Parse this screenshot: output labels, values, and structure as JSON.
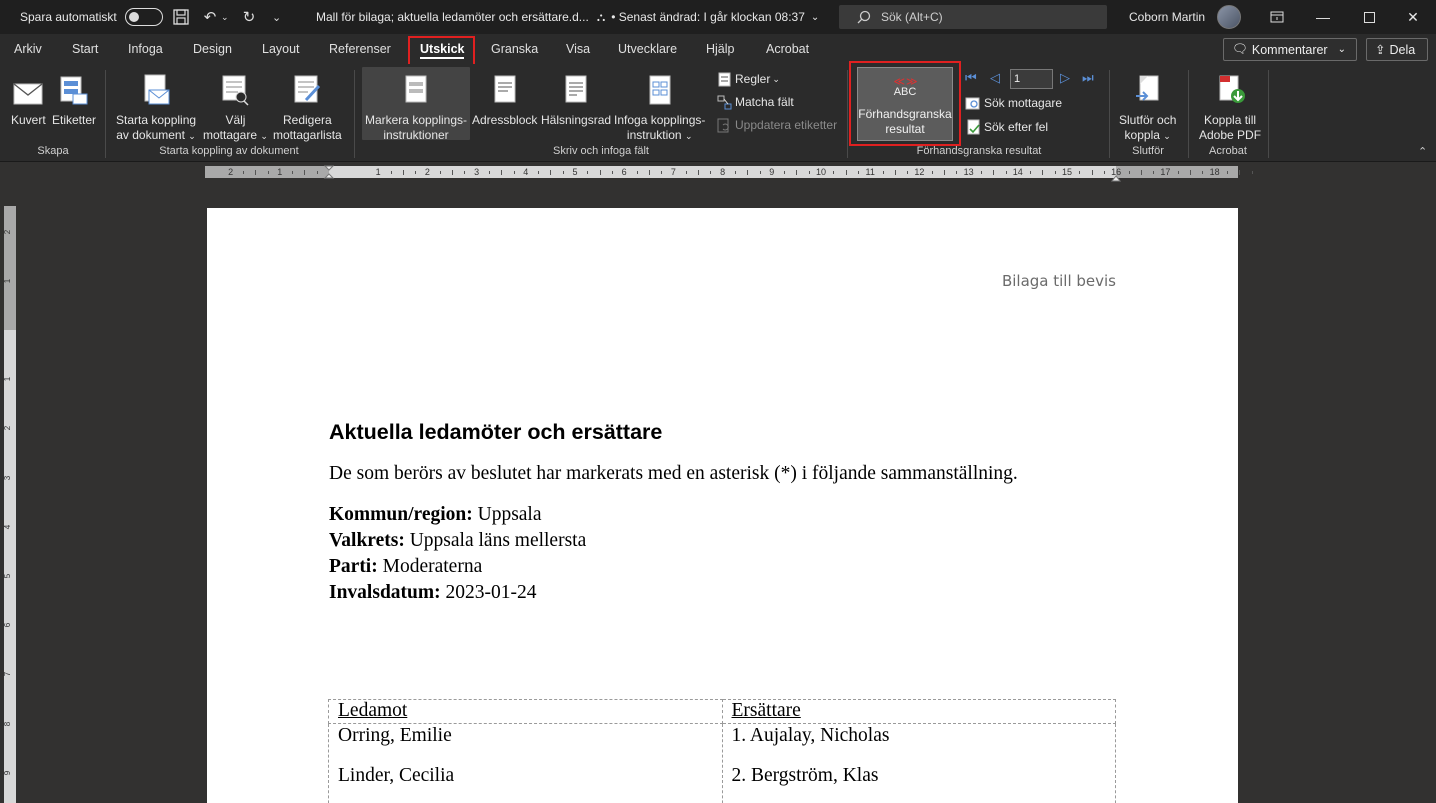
{
  "titlebar": {
    "autosave_label": "Spara automatiskt",
    "document_title": "Mall för bilaga; aktuella ledamöter och ersättare.d...",
    "last_modified": "• Senast ändrad: I går klockan 08:37",
    "search_placeholder": "Sök (Alt+C)",
    "user_name": "Coborn Martin"
  },
  "tabs": [
    "Arkiv",
    "Start",
    "Infoga",
    "Design",
    "Layout",
    "Referenser",
    "Utskick",
    "Granska",
    "Visa",
    "Utvecklare",
    "Hjälp",
    "Acrobat"
  ],
  "active_tab": "Utskick",
  "header_buttons": {
    "comments": "Kommentarer",
    "share": "Dela"
  },
  "ribbon": {
    "skapa": {
      "envelope": "Kuvert",
      "labels": "Etiketter",
      "group": "Skapa"
    },
    "starta": {
      "start_line1": "Starta koppling",
      "start_line2": "av dokument",
      "select_line1": "Välj",
      "select_line2": "mottagare",
      "edit_line1": "Redigera",
      "edit_line2": "mottagarlista",
      "group": "Starta koppling av dokument"
    },
    "skriv": {
      "highlight_line1": "Markera kopplings-",
      "highlight_line2": "instruktioner",
      "address": "Adressblock",
      "greeting": "Hälsningsrad",
      "insert_line1": "Infoga kopplings-",
      "insert_line2": "instruktion",
      "rules": "Regler",
      "match": "Matcha fält",
      "update": "Uppdatera etiketter",
      "group": "Skriv och infoga fält"
    },
    "preview": {
      "abc": "ABC",
      "label_line1": "Förhandsgranska",
      "label_line2": "resultat",
      "record": "1",
      "find_recipient": "Sök mottagare",
      "check_errors": "Sök efter fel",
      "group": "Förhandsgranska resultat"
    },
    "slutfor": {
      "label_line1": "Slutför och",
      "label_line2": "koppla",
      "group": "Slutför"
    },
    "acrobat": {
      "label_line1": "Koppla till",
      "label_line2": "Adobe PDF",
      "group": "Acrobat"
    }
  },
  "ruler": {
    "h_labels": [
      "2",
      "1",
      "1",
      "2",
      "3",
      "4",
      "5",
      "6",
      "7",
      "8",
      "9",
      "10",
      "11",
      "12",
      "13",
      "14",
      "15",
      "16",
      "17",
      "18"
    ],
    "v_labels": [
      "2",
      "1",
      "1",
      "2",
      "3",
      "4",
      "5",
      "6",
      "7",
      "8",
      "9"
    ]
  },
  "document": {
    "header": "Bilaga till bevis",
    "title": "Aktuella ledamöter och ersättare",
    "intro": "De som berörs av beslutet har markerats med en asterisk (*) i följande sammanställning.",
    "meta": [
      {
        "label": "Kommun/region:",
        "value": "Uppsala"
      },
      {
        "label": "Valkrets:",
        "value": "Uppsala läns mellersta"
      },
      {
        "label": "Parti:",
        "value": "Moderaterna"
      },
      {
        "label": "Invalsdatum:",
        "value": "2023-01-24"
      }
    ],
    "table": {
      "headers": [
        "Ledamot",
        "Ersättare"
      ],
      "members": [
        "Orring, Emilie",
        "Linder, Cecilia"
      ],
      "substitutes": [
        "1. Aujalay, Nicholas",
        "2. Bergström, Klas"
      ]
    }
  },
  "colors": {
    "highlight_red": "#e02020",
    "nav_blue": "#5b8fd6"
  }
}
